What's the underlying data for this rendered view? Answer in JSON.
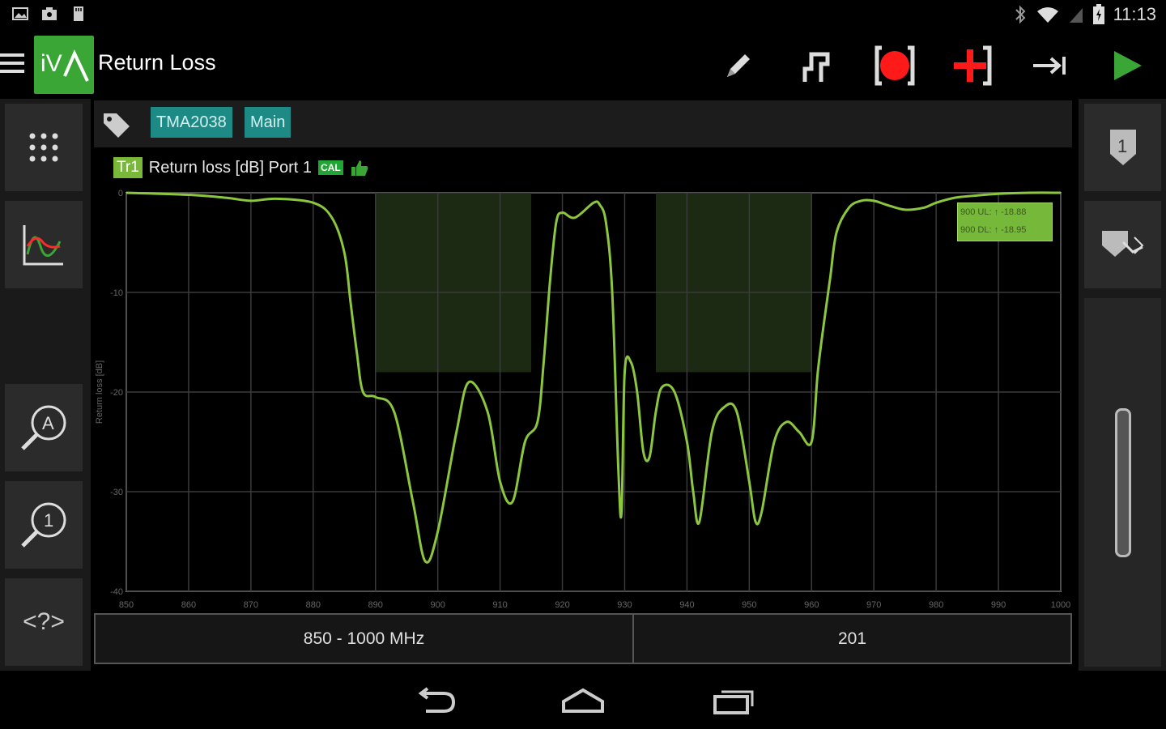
{
  "statusbar": {
    "time": "11:13"
  },
  "app": {
    "title": "Return Loss",
    "logo_text": "iV"
  },
  "tags": [
    "TMA2038",
    "Main"
  ],
  "trace": {
    "badge": "Tr1",
    "label": "Return loss [dB]  Port 1",
    "cal_badge": "CAL"
  },
  "markers": [
    "900 UL: ↑ -18.88",
    "900 DL: ↑ -18.95"
  ],
  "bottombar": {
    "range": "850 -  1000  MHz",
    "points": "201"
  },
  "left_panel": {
    "help_label": "<?>"
  },
  "right_panel": {
    "trace_number": "1"
  },
  "colors": {
    "accent": "#3aa635",
    "trace": "#8cc63f",
    "tag": "#1e8a86",
    "band_fill": "#1c2a14",
    "record": "#ff1a1a"
  },
  "chart_data": {
    "type": "line",
    "ylabel": "Return loss [dB]",
    "xlim": [
      850,
      1000
    ],
    "ylim": [
      -40,
      0
    ],
    "xticks": [
      850,
      860,
      870,
      880,
      890,
      900,
      910,
      920,
      930,
      940,
      950,
      960,
      970,
      980,
      990,
      1000
    ],
    "yticks": [
      0,
      -10,
      -20,
      -30,
      -40
    ],
    "grid": true,
    "bands": [
      {
        "x": [
          890,
          915
        ],
        "y": [
          0,
          -18
        ]
      },
      {
        "x": [
          935,
          960
        ],
        "y": [
          0,
          -18
        ]
      }
    ],
    "series": [
      {
        "x": [
          850,
          860,
          866,
          870,
          874,
          880,
          883,
          885,
          886,
          887,
          888,
          890,
          893,
          896,
          898,
          900,
          903,
          905,
          908,
          910,
          912,
          914,
          916,
          917,
          918,
          919,
          920,
          922,
          925,
          926,
          927,
          928,
          929,
          929.5,
          930,
          931,
          932,
          933,
          934,
          935,
          936,
          938,
          940,
          941,
          942,
          944,
          946,
          948,
          950,
          951,
          952,
          954,
          956,
          958,
          960,
          961,
          962,
          963,
          964,
          966,
          968,
          970,
          972,
          975,
          978,
          980,
          983,
          986,
          990,
          995,
          1000
        ],
        "y": [
          0.0,
          -0.2,
          -0.5,
          -0.8,
          -0.6,
          -1.0,
          -2.5,
          -6.0,
          -11.0,
          -16.0,
          -20.0,
          -20.5,
          -22.0,
          -31.0,
          -37.0,
          -34.0,
          -24.0,
          -19.0,
          -22.0,
          -29.0,
          -31.0,
          -25.0,
          -23.0,
          -17.0,
          -9.0,
          -3.0,
          -2.0,
          -2.5,
          -1.0,
          -1.2,
          -3.0,
          -10.0,
          -28.0,
          -32.0,
          -18.0,
          -17.0,
          -20.0,
          -26.0,
          -26.5,
          -22.0,
          -19.5,
          -20.0,
          -25.0,
          -30.0,
          -33.0,
          -24.0,
          -21.5,
          -22.0,
          -29.0,
          -33.0,
          -32.0,
          -25.0,
          -23.0,
          -24.0,
          -25.0,
          -18.0,
          -13.0,
          -8.5,
          -4.0,
          -1.5,
          -0.8,
          -0.8,
          -1.2,
          -1.7,
          -1.5,
          -1.0,
          -0.5,
          -0.3,
          -0.1,
          0.0,
          0.0
        ]
      }
    ]
  }
}
